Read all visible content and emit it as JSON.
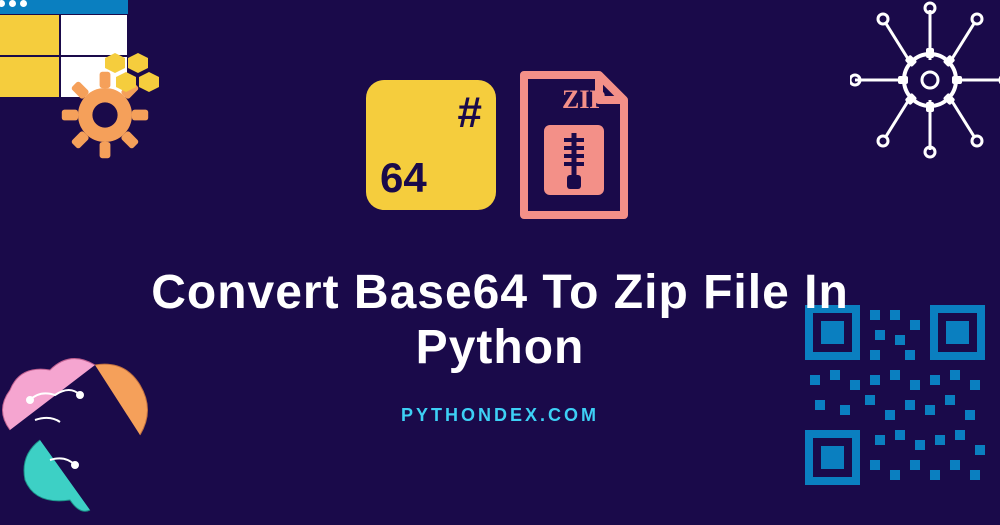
{
  "title_line1": "Convert Base64 To Zip File In",
  "title_line2": "Python",
  "url": "PYTHONDEX.COM",
  "base64_icon": {
    "hash_symbol": "#",
    "number": "64"
  },
  "zip_icon": {
    "label": "ZIP"
  },
  "colors": {
    "background": "#1a0a4a",
    "accent_yellow": "#f5cd3d",
    "accent_coral": "#f39088",
    "accent_cyan": "#3dd0f5",
    "qr_blue": "#0a7fc0",
    "brain_pink": "#f5a5d0",
    "brain_orange": "#f5a05a",
    "brain_teal": "#3dd0c5"
  },
  "decorations": {
    "top_left": "browser-window-with-gear",
    "top_right": "circuit-gear",
    "bottom_left": "brain-circuit",
    "bottom_right": "qr-code"
  }
}
